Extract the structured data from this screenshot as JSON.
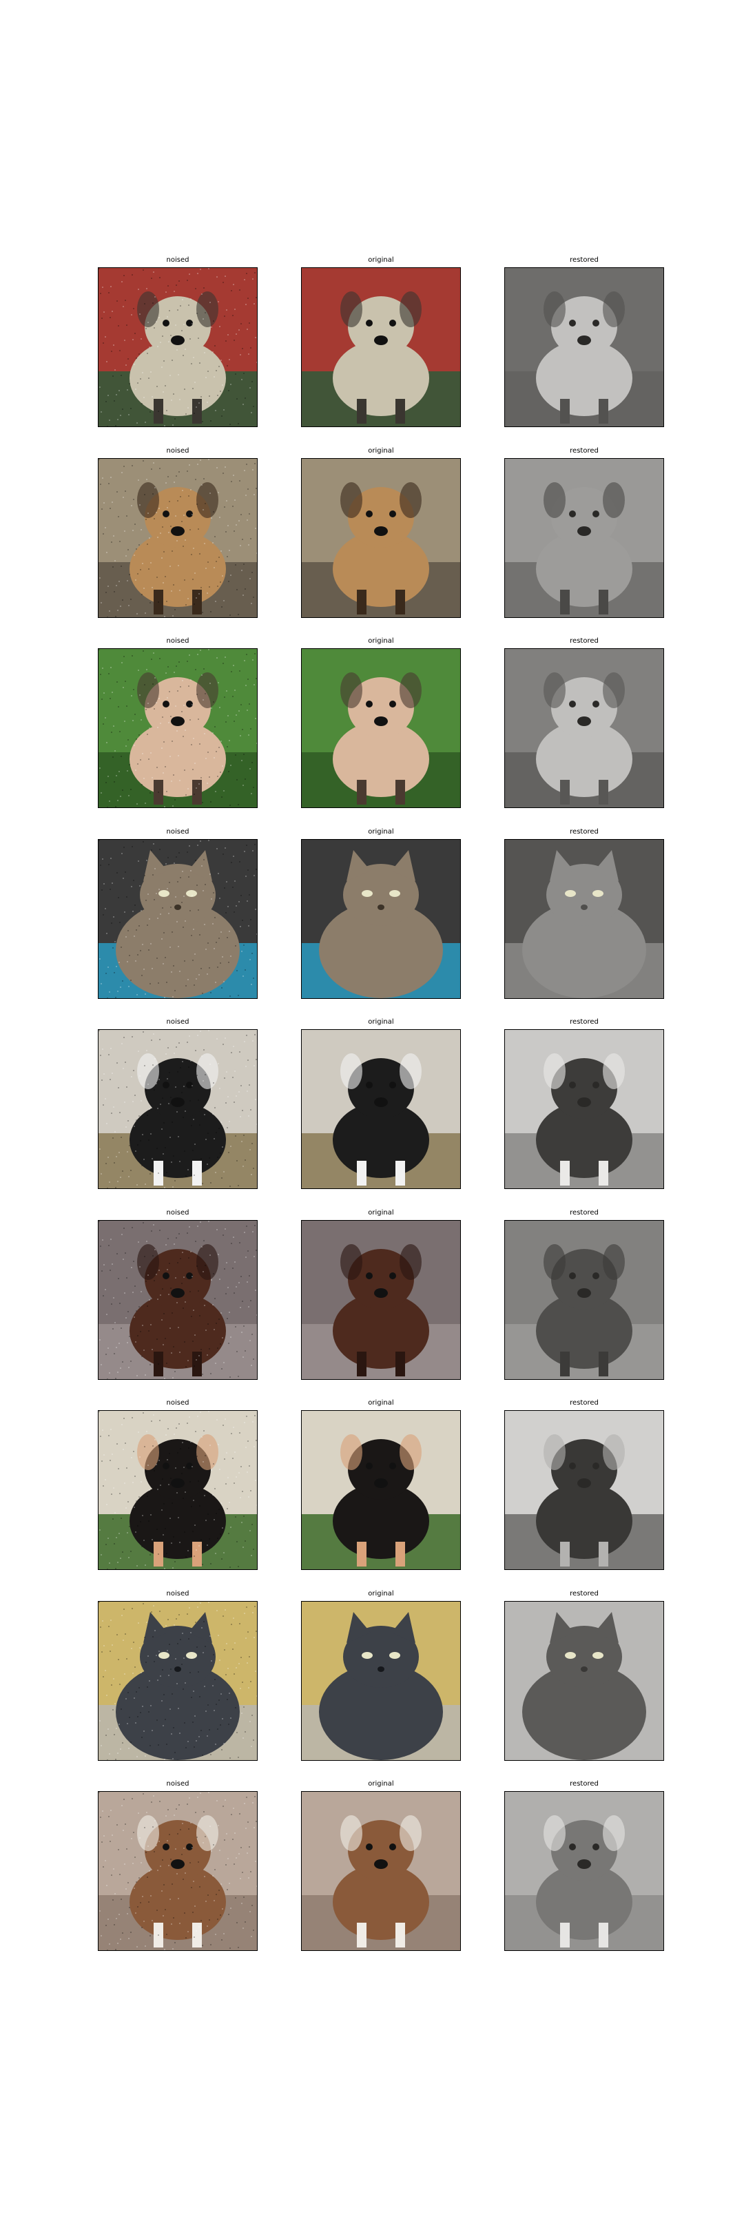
{
  "labels": {
    "noised": "noised",
    "original": "original",
    "restored": "restored"
  },
  "columns": [
    "noised",
    "original",
    "restored"
  ],
  "rows": [
    {
      "subject": "dog",
      "colors": {
        "bg": "#a53a32",
        "bg2": "#2f5a3a",
        "body": "#c9c2ad",
        "dark": "#3a3630"
      }
    },
    {
      "subject": "dog",
      "colors": {
        "bg": "#9c8f77",
        "bg2": "#5f5648",
        "body": "#b98b57",
        "dark": "#3a2a1c"
      }
    },
    {
      "subject": "dog",
      "colors": {
        "bg": "#4f8a3a",
        "bg2": "#2f5a24",
        "body": "#d9b79c",
        "dark": "#4a3a30"
      }
    },
    {
      "subject": "cat",
      "colors": {
        "bg": "#3a3a3a",
        "bg2": "#2a9ac0",
        "body": "#8c7d6a",
        "dark": "#3c3328"
      }
    },
    {
      "subject": "dog",
      "colors": {
        "bg": "#cfcac0",
        "bg2": "#8a7a55",
        "body": "#1c1c1c",
        "dark": "#f2f2f2"
      }
    },
    {
      "subject": "dog",
      "colors": {
        "bg": "#7a6f70",
        "bg2": "#9a8f8e",
        "body": "#4e2a1e",
        "dark": "#2a1610"
      }
    },
    {
      "subject": "dog",
      "colors": {
        "bg": "#d9d3c4",
        "bg2": "#3d6b2a",
        "body": "#1a1716",
        "dark": "#d9a27a"
      }
    },
    {
      "subject": "cat",
      "colors": {
        "bg": "#cdb66a",
        "bg2": "#b9b6ae",
        "body": "#3d4148",
        "dark": "#16181c"
      }
    },
    {
      "subject": "dog",
      "colors": {
        "bg": "#b9a79a",
        "bg2": "#8f7d70",
        "body": "#8a5a3a",
        "dark": "#f0ece6"
      }
    }
  ]
}
